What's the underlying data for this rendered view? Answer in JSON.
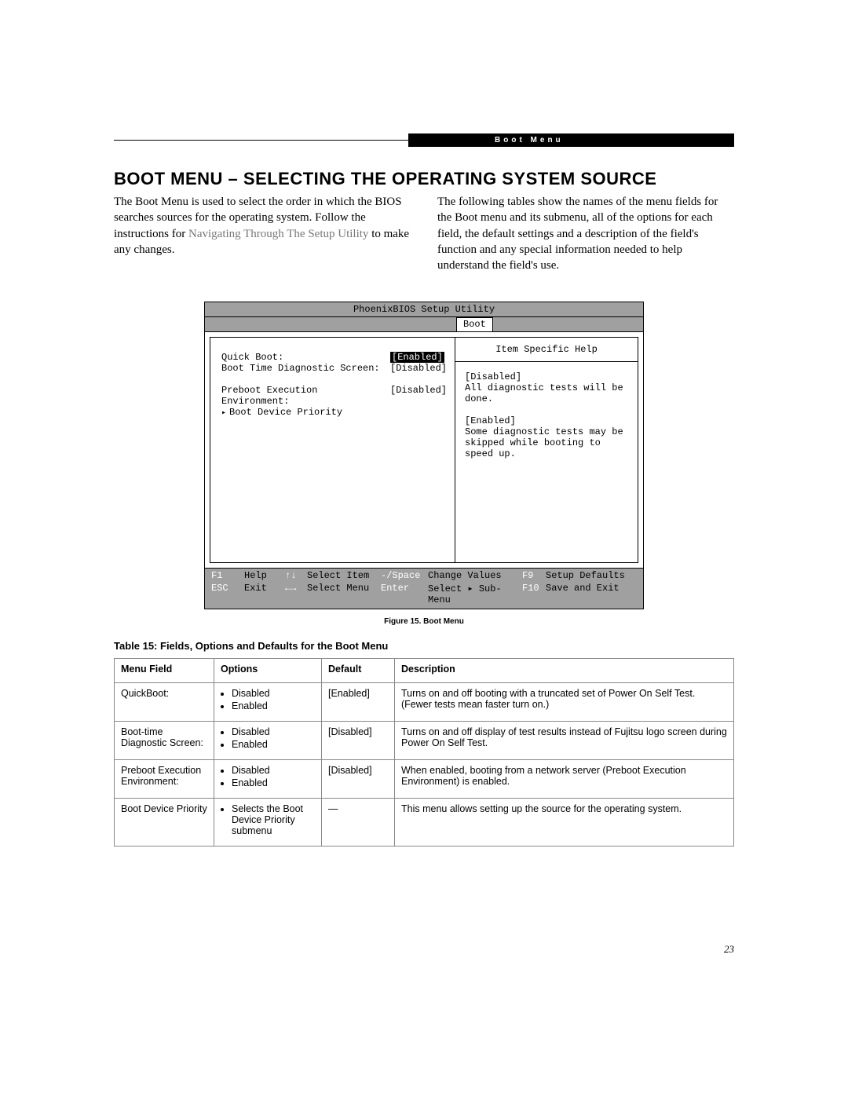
{
  "header_tab": "Boot Menu",
  "title": "BOOT MENU – SELECTING THE OPERATING SYSTEM SOURCE",
  "intro_left_a": "The Boot Menu is used to select the order in which the BIOS searches sources for the operating system. Follow the instructions for ",
  "intro_left_link": "Navigating Through The Setup Utility",
  "intro_left_b": " to make any changes.",
  "intro_right": "The following tables show the names of the menu fields for the Boot menu and its submenu, all of the options for each field, the default settings and a description of the field's function and any special information needed to help understand the field's use.",
  "bios": {
    "title": "PhoenixBIOS Setup Utility",
    "tab": "Boot",
    "rows": [
      {
        "label": "Quick Boot:",
        "value": "[Enabled]",
        "selected": true
      },
      {
        "label": "Boot Time Diagnostic Screen:",
        "value": "[Disabled]",
        "selected": false
      },
      {
        "label": "Preboot Execution Environment:",
        "value": "[Disabled]",
        "selected": false,
        "spaced": true
      },
      {
        "label": "Boot Device Priority",
        "value": "",
        "selected": false,
        "submenu": true
      }
    ],
    "help_title": "Item Specific Help",
    "help_lines": [
      "[Disabled]",
      "All diagnostic tests will be done.",
      "",
      "[Enabled]",
      "Some diagnostic tests may be skipped while booting to speed up."
    ],
    "footer": {
      "f1": "F1",
      "help": "Help",
      "arrows_v": "↑↓",
      "select_item": "Select Item",
      "space": "-/Space",
      "change_values": "Change Values",
      "f9": "F9",
      "setup_defaults": "Setup Defaults",
      "esc": "ESC",
      "exit": "Exit",
      "arrows_h": "←→",
      "select_menu": "Select Menu",
      "enter": "Enter",
      "select_sub": "Select ▸ Sub-Menu",
      "f10": "F10",
      "save_exit": "Save and Exit"
    }
  },
  "fig_caption": "Figure 15.  Boot Menu",
  "tbl_caption": "Table 15: Fields, Options and Defaults for the Boot Menu",
  "table": {
    "headers": [
      "Menu Field",
      "Options",
      "Default",
      "Description"
    ],
    "rows": [
      {
        "field": "QuickBoot:",
        "options": [
          "Disabled",
          "Enabled"
        ],
        "def": "[Enabled]",
        "desc": "Turns on and off booting with a truncated set of Power On Self Test. (Fewer tests mean faster turn on.)"
      },
      {
        "field": "Boot-time Diagnostic Screen:",
        "options": [
          "Disabled",
          "Enabled"
        ],
        "def": "[Disabled]",
        "desc": "Turns on and off display of test results instead of Fujitsu logo screen during Power On Self Test."
      },
      {
        "field": "Preboot Execution Environment:",
        "options": [
          "Disabled",
          "Enabled"
        ],
        "def": "[Disabled]",
        "desc": "When enabled, booting from a network server (Preboot Execution Environment) is enabled."
      },
      {
        "field": "Boot Device Priority",
        "options": [
          "Selects the Boot Device Priority submenu"
        ],
        "def": "—",
        "desc": "This menu allows setting up the source for the operating system."
      }
    ]
  },
  "page_num": "23"
}
